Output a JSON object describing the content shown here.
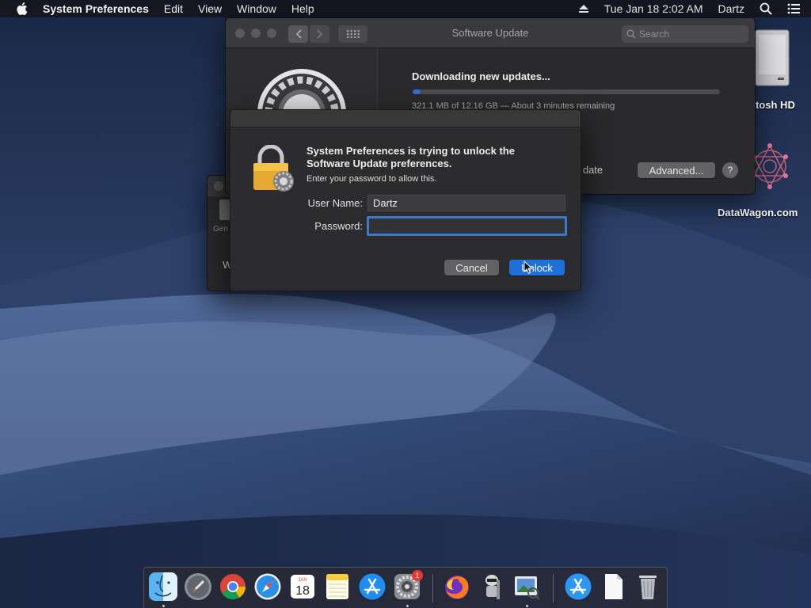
{
  "menubar": {
    "app_name": "System Preferences",
    "menus": [
      "Edit",
      "View",
      "Window",
      "Help"
    ],
    "datetime": "Tue Jan 18  2:02 AM",
    "user": "Dartz"
  },
  "desktop": {
    "drive_label": "tosh HD",
    "datawagon_label": "DataWagon.com"
  },
  "software_update": {
    "window_title": "Software Update",
    "search_placeholder": "Search",
    "status_title": "Downloading new updates...",
    "progress_text": "321.1 MB of 12.16 GB — About 3 minutes remaining",
    "progress_fraction": 0.026,
    "up_to_date_fragment": "o date",
    "advanced_button": "Advanced...",
    "help_button": "?"
  },
  "back_window": {
    "label_fragment": "Gen",
    "letter_fragment": "W"
  },
  "auth_dialog": {
    "heading": "System Preferences is trying to unlock the Software Update preferences.",
    "subheading": "Enter your password to allow this.",
    "username_label": "User Name:",
    "username_value": "Dartz",
    "password_label": "Password:",
    "password_value": "",
    "cancel_button": "Cancel",
    "unlock_button": "Unlock"
  },
  "dock": {
    "items": [
      {
        "name": "Finder",
        "icon": "finder-icon",
        "running": true
      },
      {
        "name": "Launchpad",
        "icon": "launchpad-icon",
        "running": false
      },
      {
        "name": "Chrome",
        "icon": "chrome-icon",
        "running": false
      },
      {
        "name": "Safari",
        "icon": "safari-icon",
        "running": false
      },
      {
        "name": "Calendar",
        "icon": "calendar-icon",
        "running": false,
        "month": "JAN",
        "day": "18"
      },
      {
        "name": "Notes",
        "icon": "notes-icon",
        "running": false
      },
      {
        "name": "App Store",
        "icon": "app-store-icon",
        "running": false
      },
      {
        "name": "System Preferences",
        "icon": "system-preferences-icon",
        "running": true,
        "badge": "1"
      },
      {
        "name": "Firefox",
        "icon": "firefox-icon",
        "running": false
      },
      {
        "name": "Automator",
        "icon": "automator-icon",
        "running": false
      },
      {
        "name": "Preview",
        "icon": "preview-icon",
        "running": true
      },
      {
        "name": "App Store Downloads",
        "icon": "app-store-folder-icon",
        "running": false
      },
      {
        "name": "Document",
        "icon": "document-icon",
        "running": false
      },
      {
        "name": "Trash",
        "icon": "trash-icon",
        "running": false
      }
    ]
  },
  "colors": {
    "accent": "#1f6fd8",
    "focus_ring": "#3d79c8",
    "progress": "#2f6fdc"
  }
}
